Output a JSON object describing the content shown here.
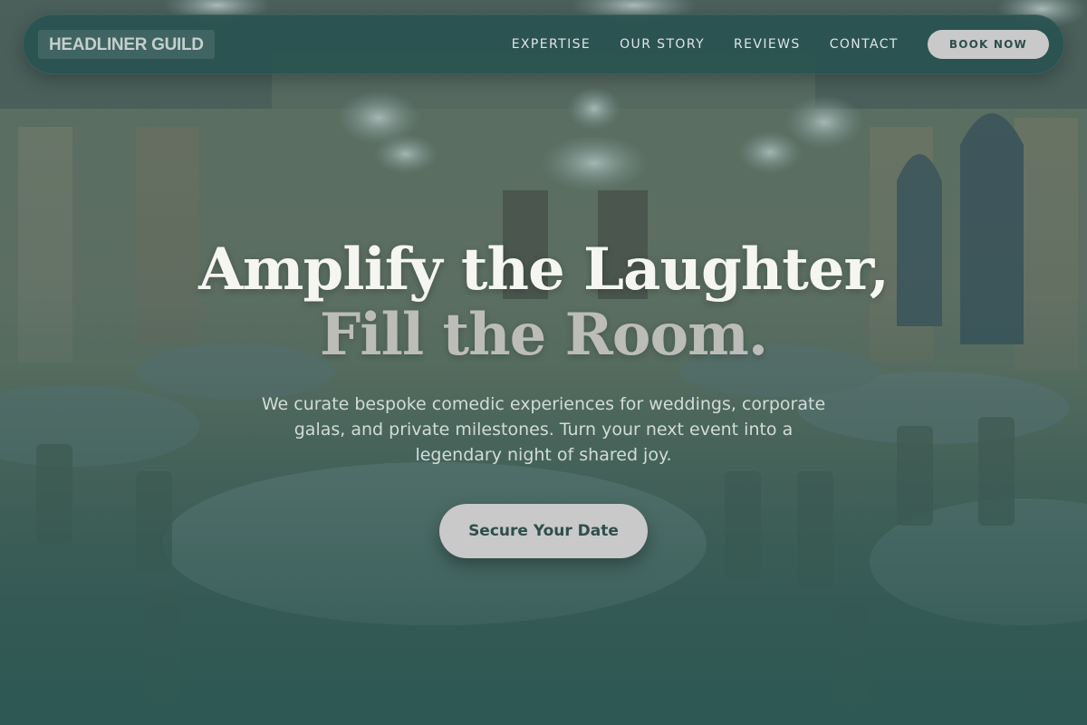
{
  "brand": {
    "logo_text": "HEADLINER GUILD"
  },
  "nav": {
    "links": [
      "EXPERTISE",
      "OUR STORY",
      "REVIEWS",
      "CONTACT"
    ],
    "book_label": "BOOK NOW"
  },
  "hero": {
    "headline_line1": "Amplify the Laughter,",
    "headline_line2": "Fill the Room.",
    "subtext": "We curate bespoke comedic experiences for weddings, corporate galas, and private milestones. Turn your next event into a legendary night of shared joy.",
    "cta_label": "Secure Your Date",
    "background_image": "ballroom-with-chandeliers"
  },
  "colors": {
    "overlay_teal": "#2d5553",
    "button_bg": "#c9c9c9",
    "button_text": "#2e4f4c",
    "headline_primary": "#f5f5f2",
    "headline_secondary": "#bcbcb8"
  }
}
